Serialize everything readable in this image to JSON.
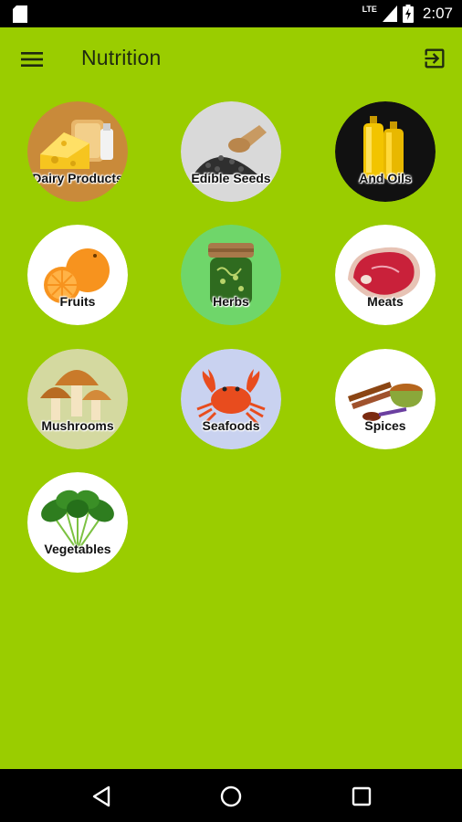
{
  "status_bar": {
    "time": "2:07",
    "network_label": "LTE",
    "icons": [
      "sd-card-icon",
      "signal-icon",
      "battery-charging-icon"
    ]
  },
  "app_bar": {
    "title": "Nutrition",
    "menu_icon": "menu-icon",
    "exit_icon": "exit-icon"
  },
  "categories": [
    {
      "label": "Dairy Products",
      "bg": "#c98a3a"
    },
    {
      "label": "Edible Seeds",
      "bg": "#d9d9d9"
    },
    {
      "label": "And Oils",
      "bg": "#111111"
    },
    {
      "label": "Fruits",
      "bg": "#ffffff"
    },
    {
      "label": "Herbs",
      "bg": "#6fd66a"
    },
    {
      "label": "Meats",
      "bg": "#ffffff"
    },
    {
      "label": "Mushrooms",
      "bg": "#d4d9a0"
    },
    {
      "label": "Seafoods",
      "bg": "#c9d2f0"
    },
    {
      "label": "Spices",
      "bg": "#ffffff"
    },
    {
      "label": "Vegetables",
      "bg": "#ffffff"
    }
  ],
  "nav_bar": {
    "buttons": [
      "back-icon",
      "home-icon",
      "recents-icon"
    ]
  }
}
